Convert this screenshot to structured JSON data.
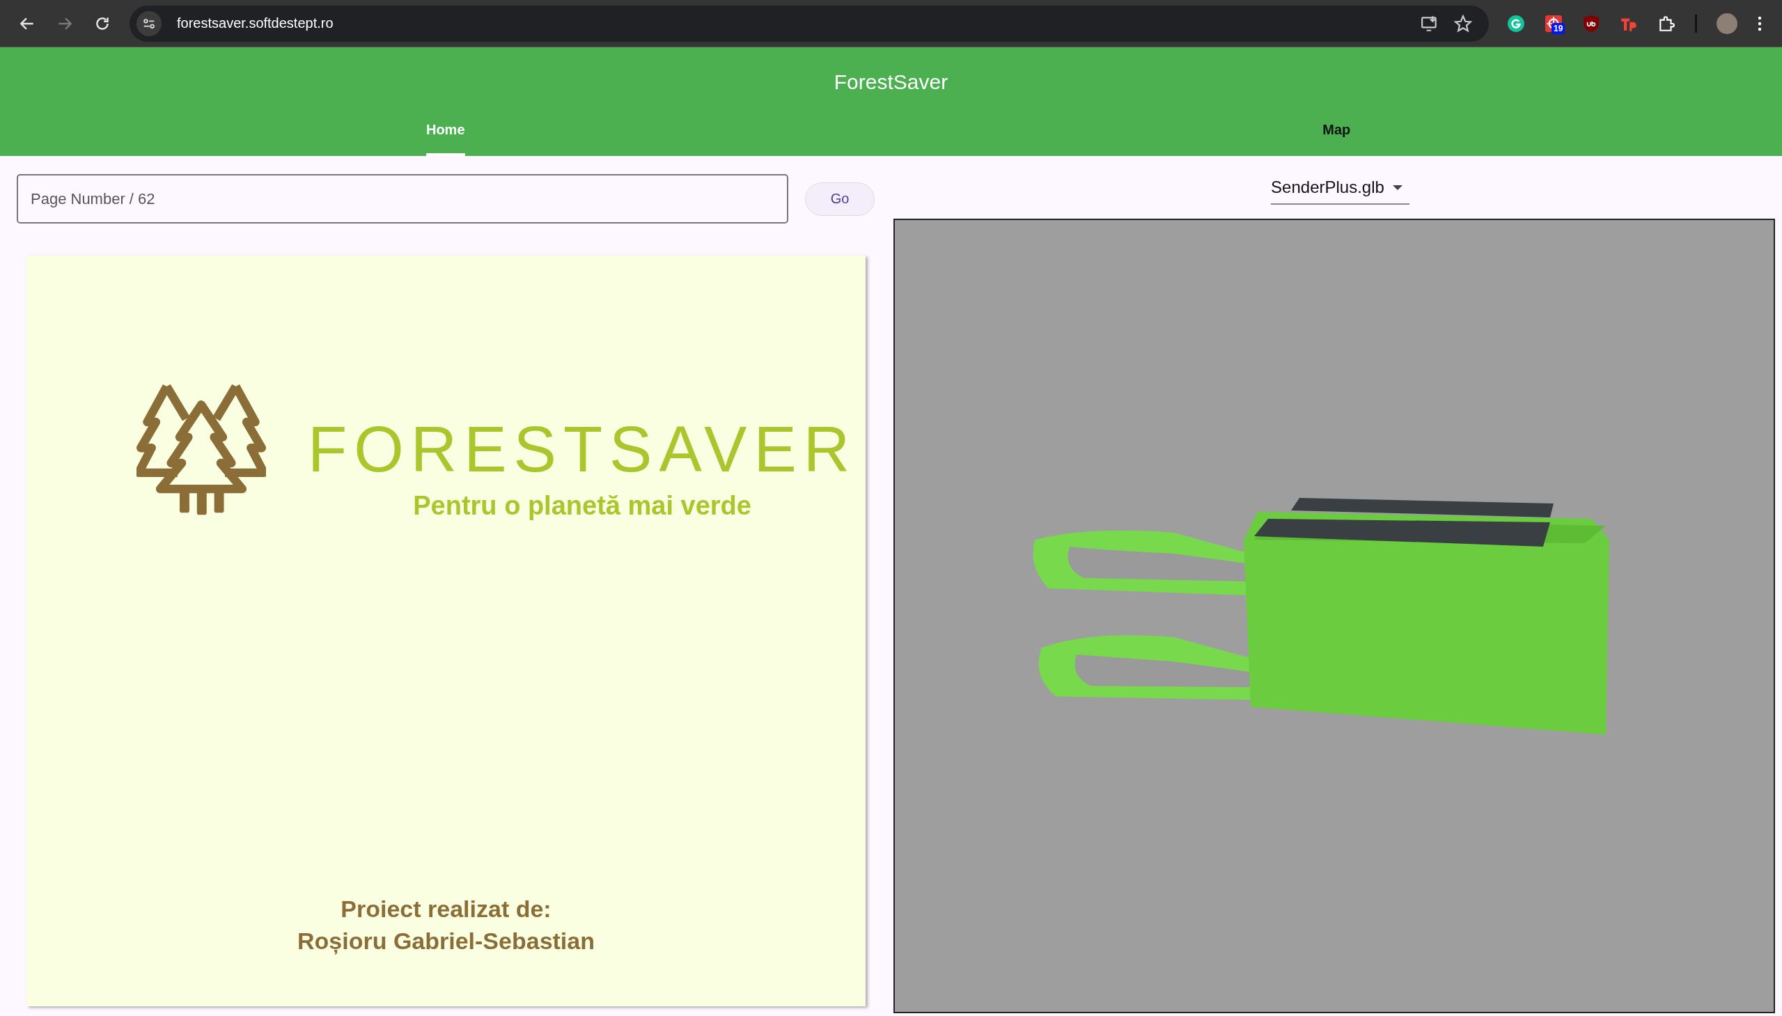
{
  "browser": {
    "url": "forestsaver.softdestept.ro",
    "nav": [
      {
        "kind": "back",
        "disabled": false
      },
      {
        "kind": "forward",
        "disabled": true
      },
      {
        "kind": "reload",
        "disabled": false
      }
    ],
    "extension_badge": "19"
  },
  "app": {
    "title": "ForestSaver"
  },
  "tabs": [
    {
      "label": "Home",
      "selected": true
    },
    {
      "label": "Map",
      "selected": false
    }
  ],
  "pager": {
    "placeholder": "Page Number / 62",
    "button": "Go"
  },
  "slide": {
    "logo_word": "FORESTSAVER",
    "tagline": "Pentru o planetă mai verde",
    "credit_lines": [
      "Proiect realizat de:",
      "Roșioru Gabriel-Sebastian"
    ]
  },
  "model_picker": {
    "value": "SenderPlus.glb"
  }
}
